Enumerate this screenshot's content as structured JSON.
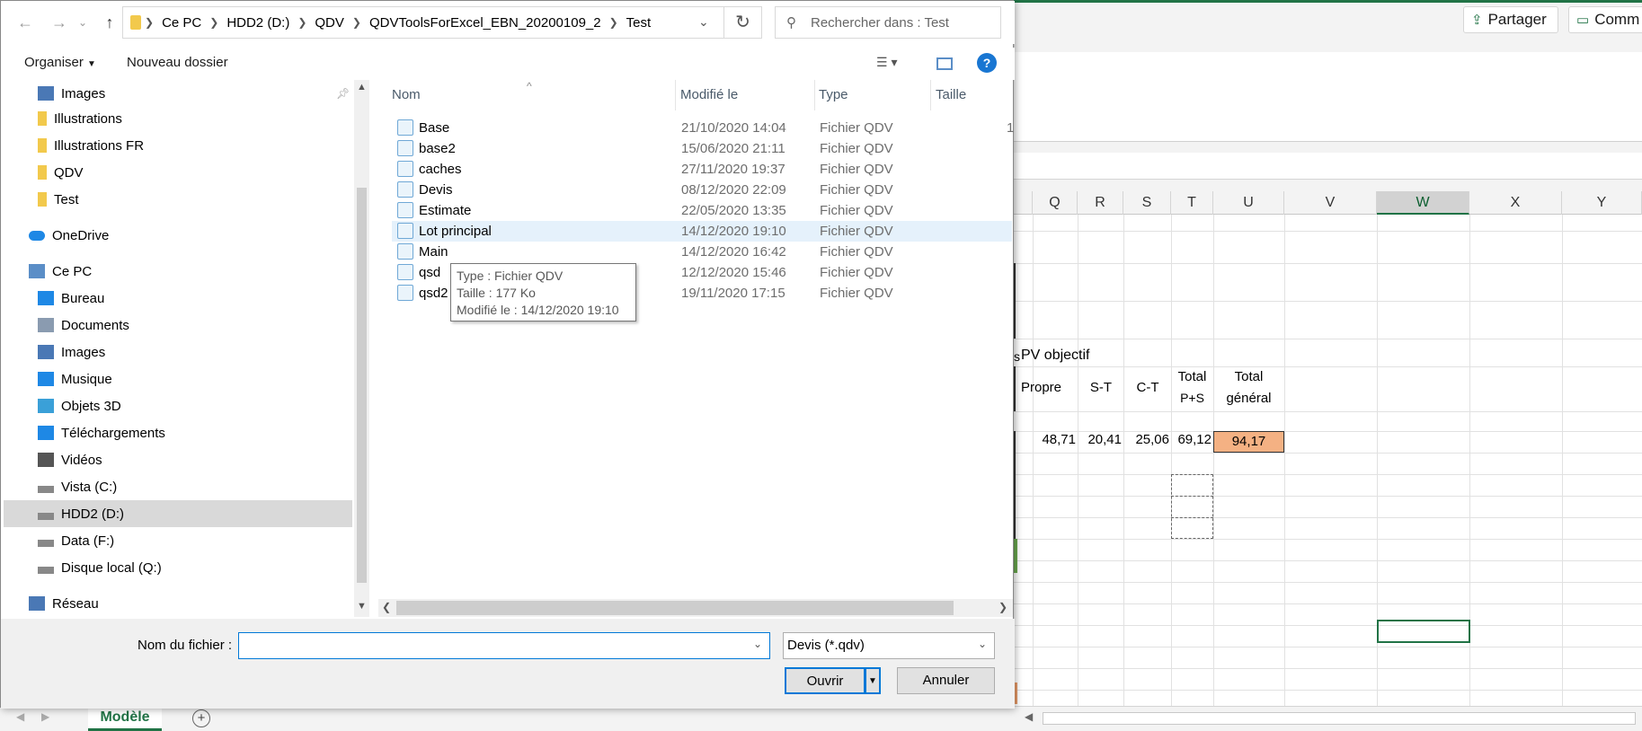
{
  "excel": {
    "share_label": "Partager",
    "comment_label": "Comm",
    "columns": [
      "Q",
      "R",
      "S",
      "T",
      "U",
      "V",
      "W",
      "X",
      "Y"
    ],
    "selected_column": "W",
    "cells": {
      "pv_objectif": "PV objectif",
      "s_frag": "s",
      "propre": "Propre",
      "st": "S-T",
      "ct": "C-T",
      "total_ps_1": "Total",
      "total_ps_2": "P+S",
      "total_gen_1": "Total",
      "total_gen_2": "général",
      "v_propre": "48,71",
      "v_st": "20,41",
      "v_ct": "25,06",
      "v_total_ps": "69,12",
      "v_total_gen": "94,17"
    },
    "sheet_tab": "Modèle",
    "accent": "#217346",
    "highlight_cell": "#f4b183"
  },
  "dialog": {
    "breadcrumb": [
      "Ce PC",
      "HDD2 (D:)",
      "QDV",
      "QDVToolsForExcel_EBN_20200109_2",
      "Test"
    ],
    "search_placeholder": "Rechercher dans : Test",
    "toolbar": {
      "organize": "Organiser",
      "new_folder": "Nouveau dossier"
    },
    "nav_items": [
      {
        "label": "Images",
        "icon": "images-icon"
      },
      {
        "label": "Illustrations",
        "icon": "folder-icon"
      },
      {
        "label": "Illustrations FR",
        "icon": "folder-icon"
      },
      {
        "label": "QDV",
        "icon": "folder-icon"
      },
      {
        "label": "Test",
        "icon": "folder-icon"
      },
      {
        "label": "OneDrive",
        "icon": "cloud-icon"
      },
      {
        "label": "Ce PC",
        "icon": "computer-icon"
      },
      {
        "label": "Bureau",
        "icon": "desktop-icon"
      },
      {
        "label": "Documents",
        "icon": "documents-icon"
      },
      {
        "label": "Images",
        "icon": "images-icon"
      },
      {
        "label": "Musique",
        "icon": "music-icon"
      },
      {
        "label": "Objets 3D",
        "icon": "3d-icon"
      },
      {
        "label": "Téléchargements",
        "icon": "download-icon"
      },
      {
        "label": "Vidéos",
        "icon": "video-icon"
      },
      {
        "label": "Vista (C:)",
        "icon": "drive-icon"
      },
      {
        "label": "HDD2 (D:)",
        "icon": "drive-icon"
      },
      {
        "label": "Data (F:)",
        "icon": "drive-icon"
      },
      {
        "label": "Disque local (Q:)",
        "icon": "drive-icon"
      },
      {
        "label": "Réseau",
        "icon": "network-icon"
      }
    ],
    "columns": {
      "name": "Nom",
      "modified": "Modifié le",
      "type": "Type",
      "size": "Taille"
    },
    "files": [
      {
        "name": "Base",
        "modified": "21/10/2020 14:04",
        "type": "Fichier QDV"
      },
      {
        "name": "base2",
        "modified": "15/06/2020 21:11",
        "type": "Fichier QDV"
      },
      {
        "name": "caches",
        "modified": "27/11/2020 19:37",
        "type": "Fichier QDV"
      },
      {
        "name": "Devis",
        "modified": "08/12/2020 22:09",
        "type": "Fichier QDV"
      },
      {
        "name": "Estimate",
        "modified": "22/05/2020 13:35",
        "type": "Fichier QDV"
      },
      {
        "name": "Lot principal",
        "modified": "14/12/2020 19:10",
        "type": "Fichier QDV"
      },
      {
        "name": "Main",
        "modified": "14/12/2020 16:42",
        "type": "Fichier QDV"
      },
      {
        "name": "qsd",
        "modified": "12/12/2020 15:46",
        "type": "Fichier QDV"
      },
      {
        "name": "qsd2",
        "modified": "19/11/2020 17:15",
        "type": "Fichier QDV"
      }
    ],
    "size_fragment": "1",
    "tooltip": [
      "Type : Fichier QDV",
      "Taille : 177 Ko",
      "Modifié le : 14/12/2020 19:10"
    ],
    "filename_label": "Nom du fichier :",
    "filename_value": "",
    "filetype": "Devis (*.qdv)",
    "open_label": "Ouvrir",
    "cancel_label": "Annuler"
  }
}
